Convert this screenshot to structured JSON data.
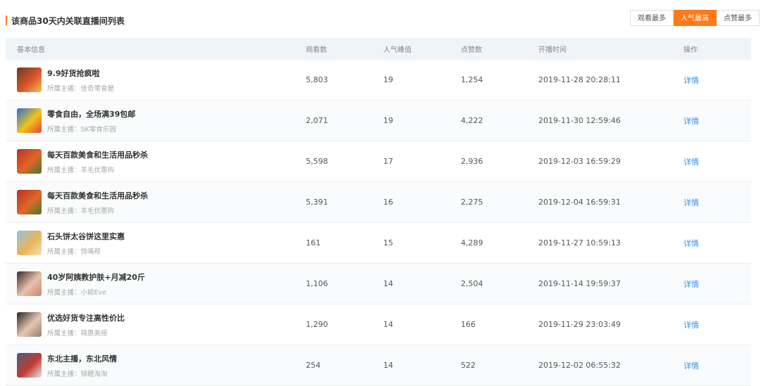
{
  "header": {
    "title": "该商品30天内关联直播间列表",
    "sort_buttons": [
      {
        "label": "观看最多",
        "active": false
      },
      {
        "label": "人气最高",
        "active": true
      },
      {
        "label": "点赞最多",
        "active": false
      }
    ]
  },
  "table": {
    "columns": {
      "info": "基本信息",
      "views": "观看数",
      "peak": "人气峰值",
      "likes": "点赞数",
      "time": "开播时间",
      "op": "操作"
    },
    "rows": [
      {
        "title": "9.9好货抢疯啦",
        "anchor": "所属主播：佳奇零食屋",
        "views": "5,803",
        "peak": "19",
        "likes": "1,254",
        "time": "2019-11-28 20:28:11",
        "op": "详情",
        "thumb_colors": [
          "#6b3a1f",
          "#d9542b",
          "#f2c14e"
        ]
      },
      {
        "title": "零食自由，全场满39包邮",
        "anchor": "所属主播：SK零食乐园",
        "views": "2,071",
        "peak": "19",
        "likes": "4,222",
        "time": "2019-11-30 12:59:46",
        "op": "详情",
        "thumb_colors": [
          "#2b6cd6",
          "#f0c419",
          "#e8413c"
        ]
      },
      {
        "title": "每天百款美食和生活用品秒杀",
        "anchor": "所属主播：羊毛优惠购",
        "views": "5,598",
        "peak": "17",
        "likes": "2,936",
        "time": "2019-12-03 16:59:29",
        "op": "详情",
        "thumb_colors": [
          "#b8321e",
          "#e0662a",
          "#3f7a2c"
        ]
      },
      {
        "title": "每天百款美食和生活用品秒杀",
        "anchor": "所属主播：羊毛优惠购",
        "views": "5,391",
        "peak": "16",
        "likes": "2,275",
        "time": "2019-12-04 16:59:31",
        "op": "详情",
        "thumb_colors": [
          "#b8321e",
          "#e0662a",
          "#3f7a2c"
        ]
      },
      {
        "title": "石头饼太谷饼这里实惠",
        "anchor": "所属主播：馋嘴帮",
        "views": "161",
        "peak": "15",
        "likes": "4,289",
        "time": "2019-11-27 10:59:13",
        "op": "详情",
        "thumb_colors": [
          "#8fc6e8",
          "#e9b45a",
          "#f6e2b3"
        ]
      },
      {
        "title": "40岁阿姨教护肤+月减20斤",
        "anchor": "所属主播：小颖Eve",
        "views": "1,106",
        "peak": "14",
        "likes": "2,504",
        "time": "2019-11-14 19:59:37",
        "op": "详情",
        "thumb_colors": [
          "#3b2a26",
          "#e8c2b0",
          "#c98470"
        ]
      },
      {
        "title": "优选好货专注高性价比",
        "anchor": "所属主播：晓惠美搭",
        "views": "1,290",
        "peak": "14",
        "likes": "166",
        "time": "2019-11-29 23:03:49",
        "op": "详情",
        "thumb_colors": [
          "#2a2320",
          "#e6c6b4",
          "#9a7d6f"
        ]
      },
      {
        "title": "东北主播，东北风情",
        "anchor": "所属主播：锦鲤淘淘",
        "views": "254",
        "peak": "14",
        "likes": "522",
        "time": "2019-12-02 06:55:32",
        "op": "详情",
        "thumb_colors": [
          "#4a5f7a",
          "#c23a32",
          "#e6e6e6"
        ]
      }
    ]
  }
}
